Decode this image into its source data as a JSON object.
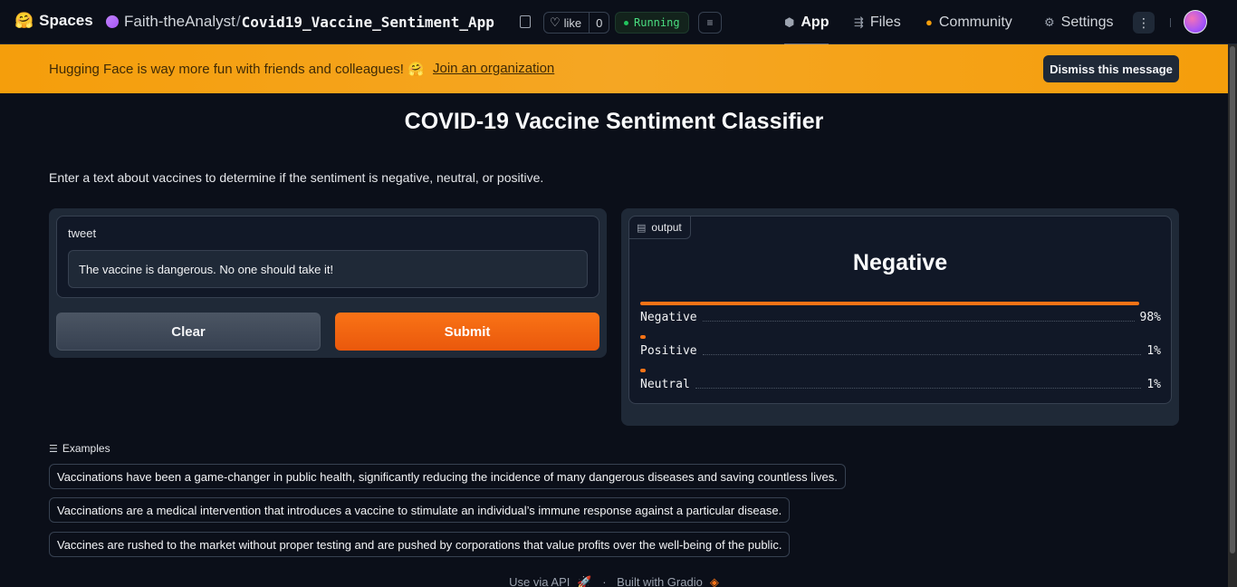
{
  "header": {
    "brand": "Spaces",
    "brand_icon": "hugging-face-emoji",
    "owner": "Faith-theAnalyst",
    "repo_name": "Covid19_Vaccine_Sentiment_App",
    "like_label": "like",
    "like_count": "0",
    "status": "Running",
    "tabs": [
      {
        "label": "App",
        "icon": "cube-icon",
        "active": true
      },
      {
        "label": "Files",
        "icon": "files-icon",
        "active": false
      },
      {
        "label": "Community",
        "icon": "community-icon",
        "active": false
      },
      {
        "label": "Settings",
        "icon": "gear-icon",
        "active": false
      }
    ]
  },
  "banner": {
    "message": "Hugging Face is way more fun with friends and colleagues! 🤗",
    "link": "Join an organization",
    "dismiss": "Dismiss this message"
  },
  "app": {
    "title": "COVID-19 Vaccine Sentiment Classifier",
    "description": "Enter a text about vaccines to determine if the sentiment is negative, neutral, or positive.",
    "input_label": "tweet",
    "input_value": "The vaccine is dangerous. No one should take it!",
    "clear_label": "Clear",
    "submit_label": "Submit",
    "output_label": "output",
    "prediction": "Negative",
    "confidences": [
      {
        "label": "Negative",
        "value": "98%",
        "fraction": 0.98
      },
      {
        "label": "Positive",
        "value": "1%",
        "fraction": 0.01
      },
      {
        "label": "Neutral",
        "value": "1%",
        "fraction": 0.01
      }
    ],
    "examples_label": "Examples",
    "examples": [
      "Vaccinations have been a game-changer in public health, significantly reducing the incidence of many dangerous diseases and saving countless lives.",
      "Vaccinations are a medical intervention that introduces a vaccine to stimulate an individual’s immune response against a particular disease.",
      "Vaccines are rushed to the market without proper testing and are pushed by corporations that value profits over the well-being of the public."
    ]
  },
  "footer": {
    "api": "Use via API",
    "api_icon": "rocket-icon",
    "separator": "·",
    "built": "Built with Gradio",
    "gradio_icon": "gradio-logo-icon"
  },
  "colors": {
    "accent": "#f97316",
    "banner": "#f59e0b",
    "status": "#22c55e",
    "background": "#0b0f19"
  }
}
